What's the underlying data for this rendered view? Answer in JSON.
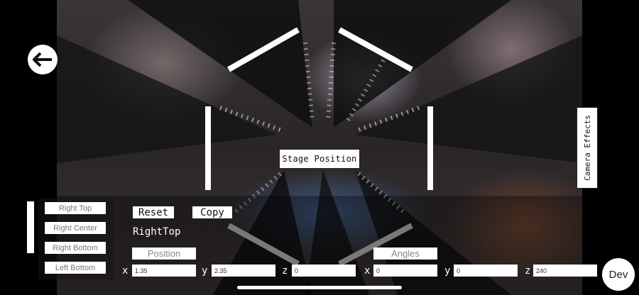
{
  "nav": {
    "back_icon": "arrow-left-icon"
  },
  "stage": {
    "label": "Stage Position"
  },
  "camera_effects": {
    "label": "Camera Effects"
  },
  "presets": {
    "items": [
      "Right Top",
      "Right Center",
      "Right Bottom",
      "Left Bottom"
    ]
  },
  "actions": {
    "reset": "Reset",
    "copy": "Copy"
  },
  "current_preset": "RightTop",
  "position": {
    "label": "Position",
    "x_label": "x",
    "y_label": "y",
    "z_label": "z",
    "x": "1.35",
    "y": "2.35",
    "z": "0"
  },
  "angles": {
    "label": "Angles",
    "x_label": "x",
    "y_label": "y",
    "z_label": "z",
    "x": "0",
    "y": "0",
    "z": "240"
  },
  "dev": {
    "label": "Dev"
  }
}
